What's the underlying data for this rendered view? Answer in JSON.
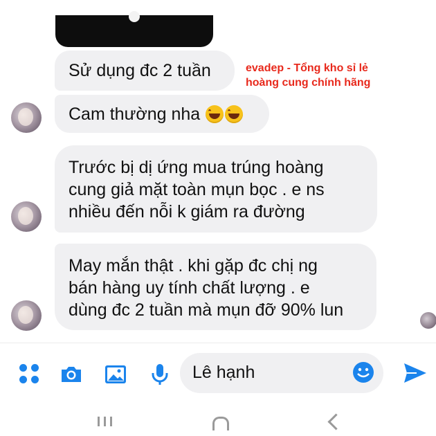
{
  "messages": [
    {
      "id": "m1",
      "text": "Sử dụng đc 2 tuần"
    },
    {
      "id": "m2",
      "text": "Cam thường nha"
    },
    {
      "id": "m3",
      "lines": [
        "Trước bị dị ứng mua trúng hoàng",
        "cung giả mặt toàn mụn bọc . e ns",
        "nhiều đến nỗi k giám ra đường"
      ]
    },
    {
      "id": "m4",
      "lines": [
        "May mắn thật . khi gặp đc chị ng",
        "bán hàng uy tính chất lượng . e",
        "dùng đc 2 tuần mà mụn đỡ 90% lun"
      ]
    }
  ],
  "watermark": {
    "line1": "evadep - Tổng kho sỉ lẻ",
    "line2": "hoàng cung chính hãng"
  },
  "composer": {
    "input_value": "Lê hạnh"
  },
  "colors": {
    "accent": "#1b84ec",
    "bubble": "#f0f0f2",
    "watermark": "#e8291c"
  },
  "icons": [
    "apps-icon",
    "camera-icon",
    "image-icon",
    "mic-icon",
    "emoji-icon",
    "send-icon",
    "laughing-emoji-icon"
  ]
}
